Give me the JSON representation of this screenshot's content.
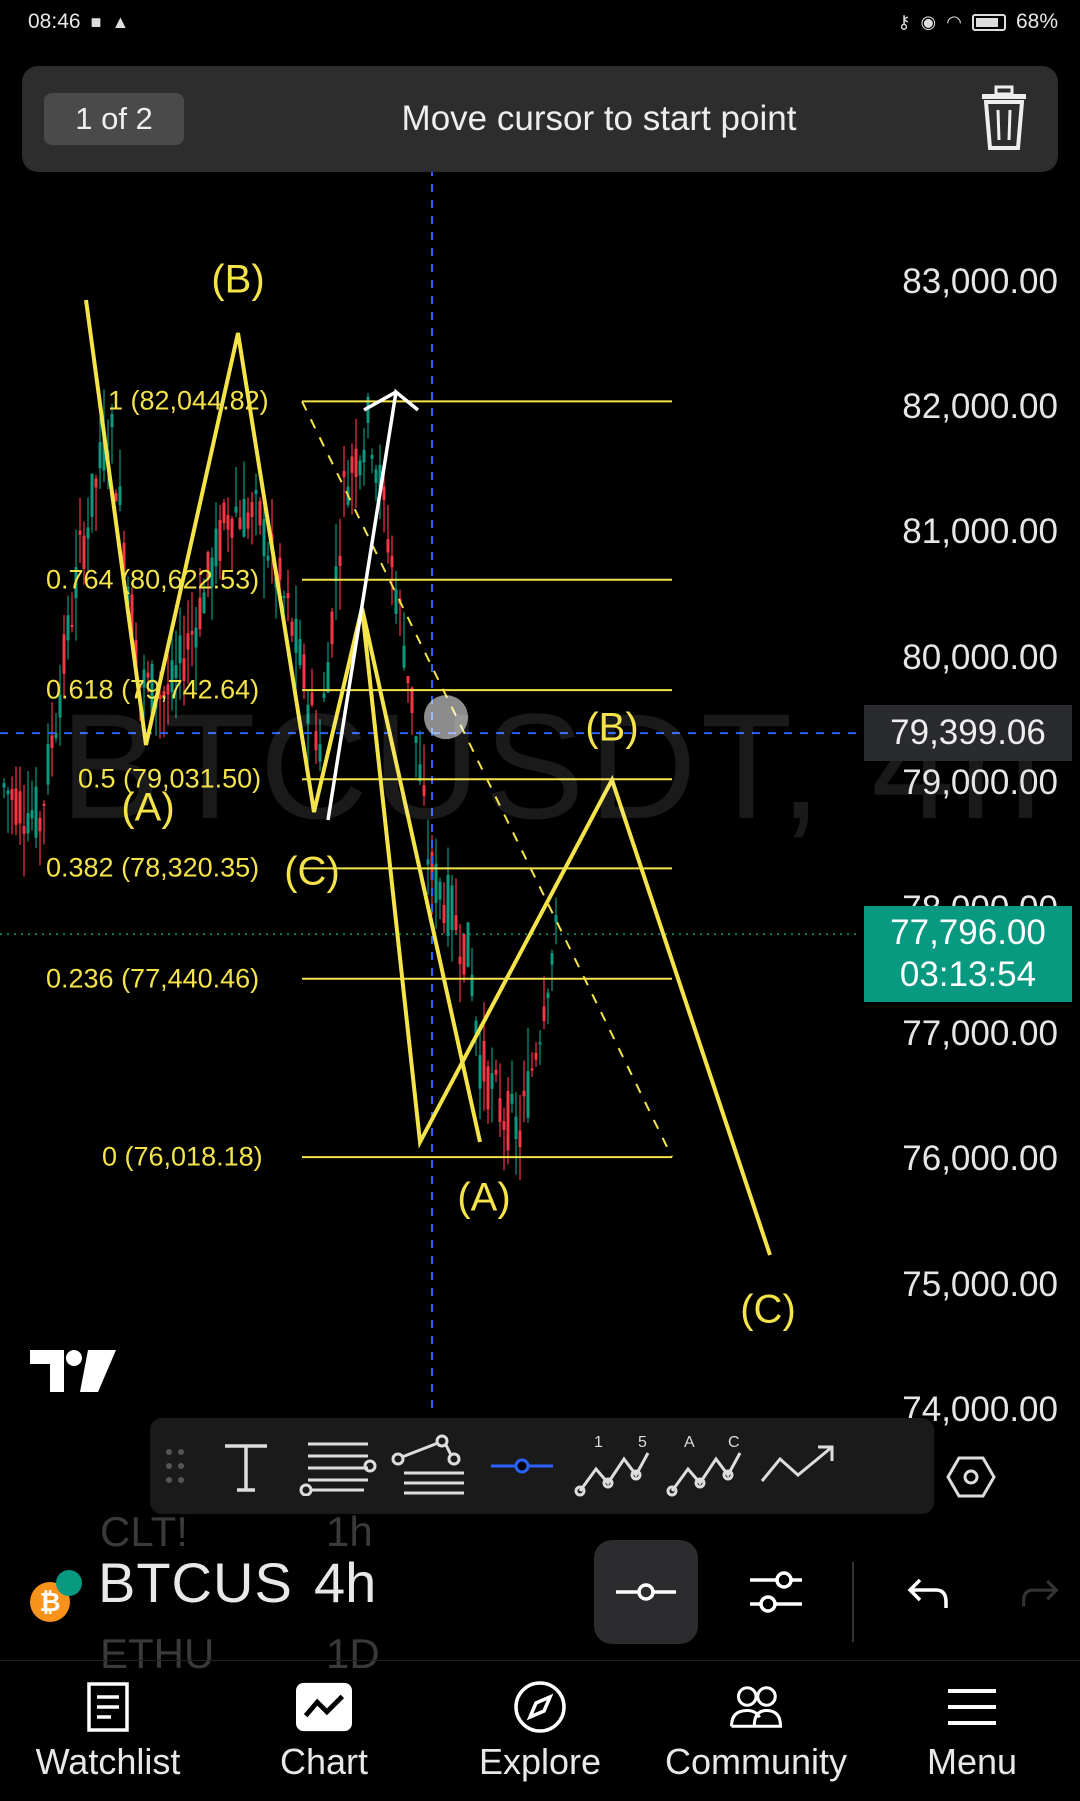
{
  "status_bar": {
    "time": "08:46",
    "battery": "68%"
  },
  "drawing_prompt": {
    "counter": "1 of 2",
    "hint": "Move cursor to start point"
  },
  "price_axis": {
    "labels": [
      {
        "text": "83,000.00",
        "value": 83000
      },
      {
        "text": "82,000.00",
        "value": 82000
      },
      {
        "text": "81,000.00",
        "value": 81000
      },
      {
        "text": "80,000.00",
        "value": 80000
      },
      {
        "text": "79,000.00",
        "value": 79000
      },
      {
        "text": "78,000.00",
        "value": 78000
      },
      {
        "text": "77,000.00",
        "value": 77000
      },
      {
        "text": "76,000.00",
        "value": 76000
      },
      {
        "text": "75,000.00",
        "value": 75000
      },
      {
        "text": "74,000.00",
        "value": 74000
      }
    ],
    "cursor_price": "79,399.06",
    "last_price": "77,796.00",
    "countdown": "03:13:54"
  },
  "fib_levels": [
    {
      "label": "1 (82,044.82)",
      "value": 82044.82
    },
    {
      "label": "0.764 (80,622.53)",
      "value": 80622.53
    },
    {
      "label": "0.618 (79,742.64)",
      "value": 79742.64
    },
    {
      "label": "0.5 (79,031.50)",
      "value": 79031.5
    },
    {
      "label": "0.382 (78,320.35)",
      "value": 78320.35
    },
    {
      "label": "0.236 (77,440.46)",
      "value": 77440.46
    },
    {
      "label": "0 (76,018.18)",
      "value": 76018.18
    }
  ],
  "wave_labels": {
    "b_left": "(B)",
    "a_left": "(A)",
    "c_left": "(C)",
    "b_right": "(B)",
    "a_right": "(A)",
    "c_right": "(C)"
  },
  "watermark": "BTCUSDT, 4h",
  "colors": {
    "background": "#000000",
    "up": "#089981",
    "down": "#f23645",
    "drawing": "#f4e44a",
    "accent": "#2962ff"
  },
  "toolbar": {
    "tools": [
      "drag-handle-icon",
      "text-tool-icon",
      "fib-retracement-icon",
      "fib-extension-icon",
      "horizontal-ray-icon",
      "elliott-impulse-icon",
      "elliott-correction-icon",
      "trend-arrow-icon",
      "settings-hex-icon"
    ],
    "elliott_impulse_marks": [
      "1",
      "5"
    ],
    "elliott_correction_marks": [
      "A",
      "C"
    ]
  },
  "symbol_bar": {
    "prev_symbol": "CLT!",
    "symbol": "BTCUS",
    "next_symbol": "ETHU",
    "prev_interval": "1h",
    "interval": "4h",
    "next_interval": "1D"
  },
  "nav": [
    {
      "label": "Watchlist",
      "icon": "watchlist-icon"
    },
    {
      "label": "Chart",
      "icon": "chart-icon"
    },
    {
      "label": "Explore",
      "icon": "compass-icon"
    },
    {
      "label": "Community",
      "icon": "community-icon"
    },
    {
      "label": "Menu",
      "icon": "menu-icon"
    }
  ]
}
